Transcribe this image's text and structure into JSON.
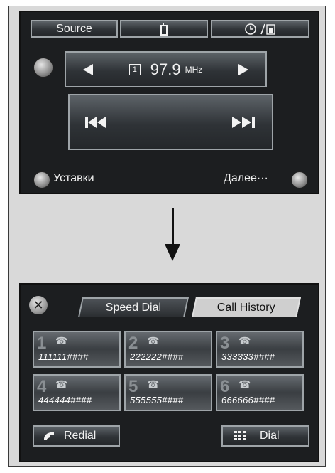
{
  "audio_screen": {
    "tabs": {
      "source_label": "Source",
      "phone_icon": "phone-icon",
      "clock_icon": "clock-icon"
    },
    "tuner": {
      "preset": "1",
      "frequency": "97.9",
      "unit": "MHz"
    },
    "presets_label": "Уставки",
    "more_label": "Далее···"
  },
  "phone_screen": {
    "tabs": {
      "speed_dial": "Speed Dial",
      "call_history": "Call History"
    },
    "entries": [
      {
        "index": "1",
        "number": "111111####"
      },
      {
        "index": "2",
        "number": "222222####"
      },
      {
        "index": "3",
        "number": "333333####"
      },
      {
        "index": "4",
        "number": "444444####"
      },
      {
        "index": "5",
        "number": "555555####"
      },
      {
        "index": "6",
        "number": "666666####"
      }
    ],
    "redial_label": "Redial",
    "dial_label": "Dial"
  },
  "colors": {
    "screen_bg": "#1c1e20",
    "button_border": "#9ea4a8",
    "frame_bg": "#d9d9d9"
  }
}
